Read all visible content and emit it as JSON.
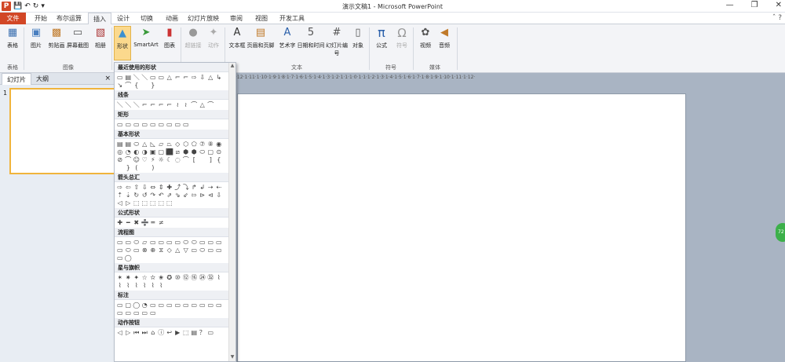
{
  "window": {
    "title": "演示文稿1 - Microsoft PowerPoint",
    "app_icon": "P",
    "quick_access": [
      "save-icon",
      "undo-icon",
      "redo-icon",
      "customize-icon"
    ],
    "controls": [
      "—",
      "❐",
      "✕"
    ]
  },
  "tabs": [
    {
      "label": "文件",
      "name": "file"
    },
    {
      "label": "开始",
      "name": "home"
    },
    {
      "label": "布尔运算",
      "name": "boolean"
    },
    {
      "label": "插入",
      "name": "insert"
    },
    {
      "label": "设计",
      "name": "design"
    },
    {
      "label": "切换",
      "name": "transitions"
    },
    {
      "label": "动画",
      "name": "animations"
    },
    {
      "label": "幻灯片放映",
      "name": "slideshow"
    },
    {
      "label": "审阅",
      "name": "review"
    },
    {
      "label": "视图",
      "name": "view"
    },
    {
      "label": "开发工具",
      "name": "developer"
    }
  ],
  "ribbon": {
    "buttons": [
      "表格",
      "图片",
      "剪贴画",
      "屏幕截图",
      "相册",
      "形状",
      "SmartArt",
      "图表",
      "超链接",
      "动作",
      "文本框",
      "页眉和页脚",
      "艺术字",
      "日期和时间",
      "幻灯片编号",
      "对象",
      "公式",
      "符号",
      "视频",
      "音频"
    ],
    "groups": [
      "表格",
      "图像",
      "文本",
      "符号",
      "媒体"
    ]
  },
  "panel": {
    "tab_slides": "幻灯片",
    "tab_outline": "大纲",
    "close": "×",
    "slide_number": "1"
  },
  "ruler": "·12·1·11·1·10·1·9·1·8·1·7·1·6·1·5·1·4·1·3·1·2·1·1·1·0·1·1·1·2·1·3·1·4·1·5·1·6·1·7·1·8·1·9·1·10·1·11·1·12·",
  "gallery": {
    "sections": [
      {
        "title": "最近使用的形状",
        "shapes": "▭▤＼＼▭▭△⌐⌐⇨⇩△↳↘⌒{ }"
      },
      {
        "title": "线条",
        "shapes": "＼＼＼⌐⌐⌐⌐≀≀⌒△⌒"
      },
      {
        "title": "矩形",
        "shapes": "▭▭▭▭▭▭▭▭▭"
      },
      {
        "title": "基本形状",
        "shapes": "▤▤⬭△◺▱⏢◇⬡⬠⑦⑧◉◎◔◐◑▣▢⬛⧄⬢⬢⬭▢⊙⊘⌒☺♡⚡☼☾◌⌒[ ]{ }( )"
      },
      {
        "title": "箭头总汇",
        "shapes": "⇨⇦⇧⇩⇔⇕✚⤴⤵↱↲⇢⇠⇡⇣↻↺↷↶⇗⇘⇙⇰⊳⊲⇩◁▷⬚⬚⬚⬚⬚"
      },
      {
        "title": "公式形状",
        "shapes": "✚━✖➗═≠"
      },
      {
        "title": "流程图",
        "shapes": "▭▭⬭▱▭▭▭▭⬭⬭▭▭▭▭⬭▭⊗⊕⧖◇△▽▭⬭▭▭▭◯"
      },
      {
        "title": "星与旗帜",
        "shapes": "✶✷✦☆✫✬✪⑩⑫⑯㉔㉜⌇⌇⌇⌇⌇⌇⌇"
      },
      {
        "title": "标注",
        "shapes": "▭▢◯◔▭▭▭▭▭▭▭▭▭▭▭▭▭▭"
      },
      {
        "title": "动作按钮",
        "shapes": "◁▷⏮⏭⌂ⓘ↩▶⬚▤？▭"
      }
    ]
  },
  "colors": {
    "file_tab": "#d24726",
    "highlight": "#fbd98d",
    "ribbon": "#f3f4f7",
    "workspace": "#a9b4c3"
  }
}
